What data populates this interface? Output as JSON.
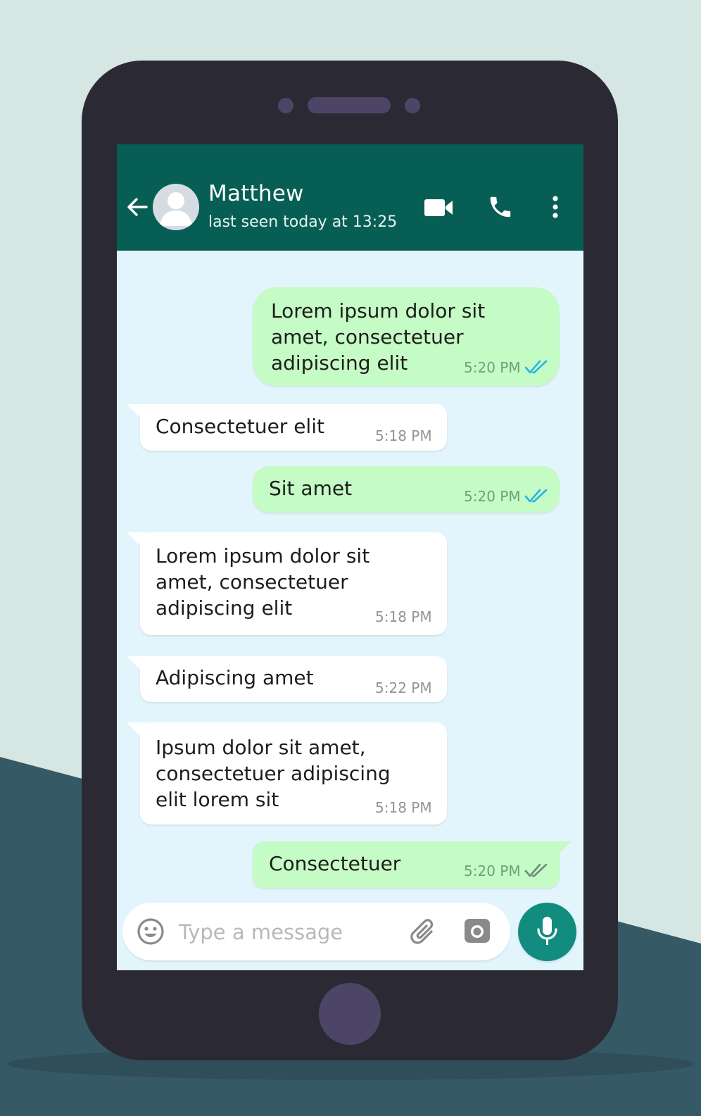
{
  "colors": {
    "header": "#075e54",
    "outgoing_bubble": "#c5fbc4",
    "incoming_bubble": "#ffffff",
    "chat_background": "#e2f5fd",
    "read_tick": "#2ab4e6",
    "mic_button": "#128c7e"
  },
  "chat_header": {
    "contact_name": "Matthew",
    "status": "last seen today at 13:25",
    "icons": [
      "back-arrow-icon",
      "avatar",
      "video-call-icon",
      "phone-icon",
      "more-options-icon"
    ]
  },
  "messages": [
    {
      "direction": "outgoing",
      "text": "Lorem ipsum dolor sit\namet, consectetuer\nadipiscing elit",
      "time": "5:20 PM",
      "status": "read"
    },
    {
      "direction": "incoming",
      "text": "Consectetuer elit",
      "time": "5:18 PM"
    },
    {
      "direction": "outgoing",
      "text": "Sit amet",
      "time": "5:20 PM",
      "status": "read"
    },
    {
      "direction": "incoming",
      "text": "Lorem ipsum dolor sit\namet, consectetuer\nadipiscing elit",
      "time": "5:18 PM"
    },
    {
      "direction": "incoming",
      "text": "Adipiscing amet",
      "time": "5:22 PM"
    },
    {
      "direction": "incoming",
      "text": "Ipsum dolor sit amet,\nconsectetuer adipiscing\nelit lorem sit",
      "time": "5:18 PM"
    },
    {
      "direction": "outgoing",
      "text": "Consectetuer",
      "time": "5:20 PM",
      "status": "delivered"
    }
  ],
  "composer": {
    "placeholder": "Type a message",
    "value": "",
    "icons": [
      "emoji-icon",
      "attach-icon",
      "camera-icon",
      "microphone-icon"
    ]
  }
}
